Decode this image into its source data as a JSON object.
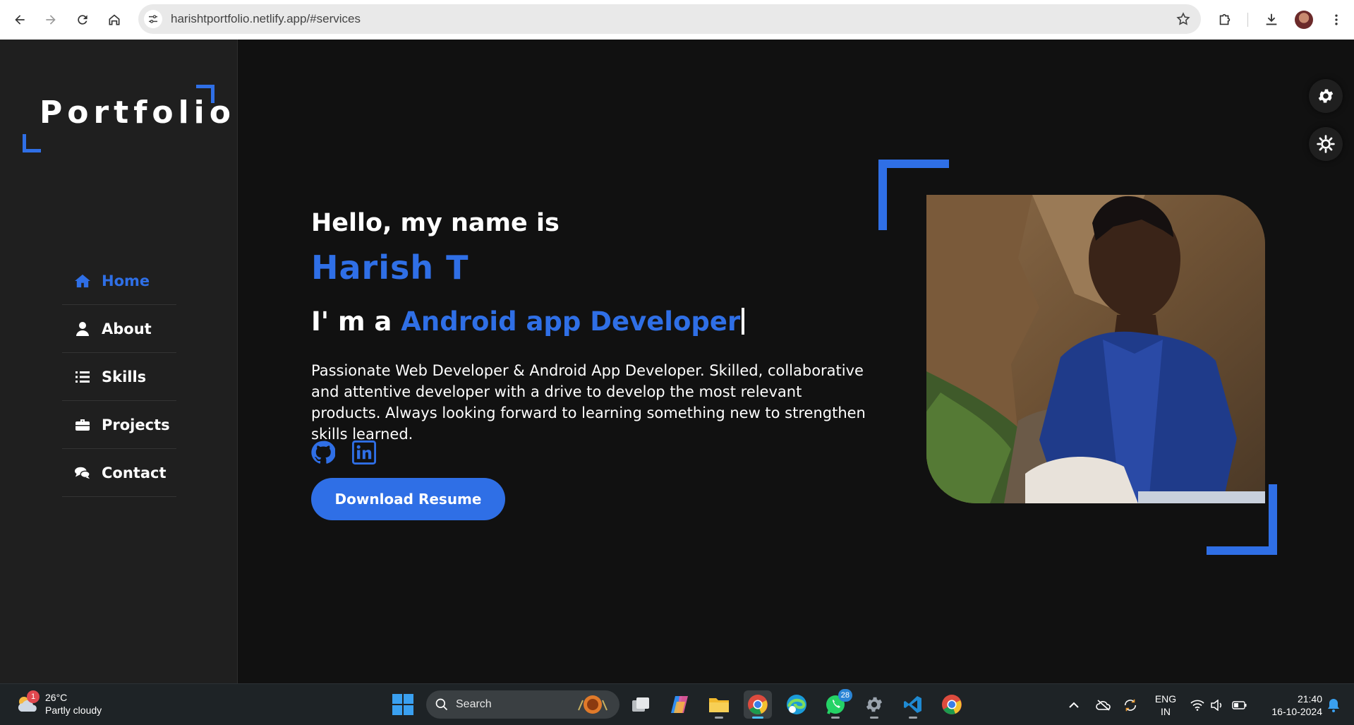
{
  "browser": {
    "url": "harishtportfolio.netlify.app/#services"
  },
  "sidebar": {
    "logo": "Portfolio",
    "items": [
      {
        "label": "Home",
        "icon": "home-icon",
        "active": true
      },
      {
        "label": "About",
        "icon": "user-icon",
        "active": false
      },
      {
        "label": "Skills",
        "icon": "list-icon",
        "active": false
      },
      {
        "label": "Projects",
        "icon": "briefcase-icon",
        "active": false
      },
      {
        "label": "Contact",
        "icon": "chat-icon",
        "active": false
      }
    ]
  },
  "hero": {
    "greeting": "Hello, my name is",
    "name": "Harish T",
    "prefix": "I' m a",
    "role": "Android app Developer",
    "bio": "Passionate Web Developer & Android App Developer. Skilled, collaborative and attentive developer with a drive to develop the most relevant products. Always looking forward to learning something new to strengthen skills learned.",
    "socials": [
      "github-icon",
      "linkedin-icon"
    ],
    "resume_label": "Download Resume"
  },
  "colors": {
    "accent": "#2f6fe6",
    "background": "#111111",
    "sidebar": "#1f1f1f"
  },
  "taskbar": {
    "weather_temp": "26°C",
    "weather_desc": "Partly cloudy",
    "weather_badge": "1",
    "search_label": "Search",
    "whatsapp_badge": "28",
    "lang_line1": "ENG",
    "lang_line2": "IN",
    "time": "21:40",
    "date": "16-10-2024"
  }
}
